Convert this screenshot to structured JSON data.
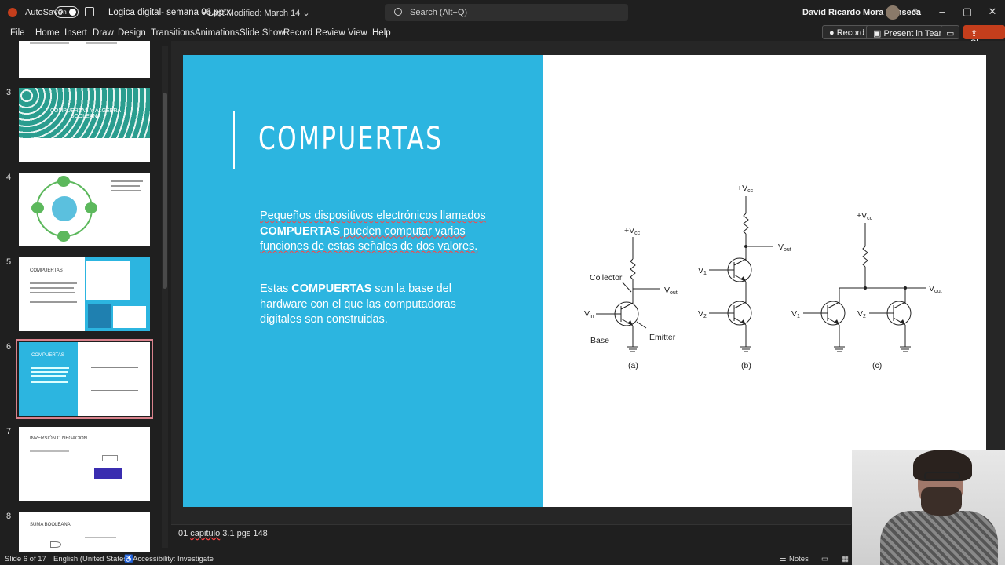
{
  "titlebar": {
    "autosave_label": "AutoSave",
    "autosave_state": "On",
    "document_title": "Logica digital- semana 06.pptx",
    "last_modified": "• Last Modified: March 14 ⌄",
    "search_placeholder": "Search (Alt+Q)",
    "user_name": "David Ricardo Mora Fonseca"
  },
  "ribbon": {
    "tabs": [
      "File",
      "Home",
      "Insert",
      "Draw",
      "Design",
      "Transitions",
      "Animations",
      "Slide Show",
      "Record",
      "Review",
      "View",
      "Help"
    ],
    "record_label": "Record",
    "present_label": "Present in Teams",
    "share_label": "Share"
  },
  "thumbnails": [
    {
      "num": "3",
      "title": "COMPUERTAS Y ÁLGEBRA BOOLEANA"
    },
    {
      "num": "4",
      "title": ""
    },
    {
      "num": "5",
      "title": "COMPUERTAS"
    },
    {
      "num": "6",
      "title": "COMPUERTAS"
    },
    {
      "num": "7",
      "title": "INVERSIÓN O NEGACIÓN"
    },
    {
      "num": "8",
      "title": "SUMA BOOLEANA"
    }
  ],
  "slide": {
    "title": "COMPUERTAS",
    "p1_a": "Pequeños dispositivos electrónicos llamados ",
    "p1_b": "COMPUERTAS",
    "p1_c": " pueden computar varias funciones de estas señales de dos valores.",
    "p2_a": "Estas ",
    "p2_b": "COMPUERTAS",
    "p2_c": " son la base del hardware con el que las computadoras digitales son construidas."
  },
  "diagram": {
    "labels": {
      "vcc": "+V",
      "vcc_sub": "cc",
      "vout": "V",
      "vout_sub": "out",
      "vin": "V",
      "vin_sub": "in",
      "v1": "V",
      "v1_sub": "1",
      "v2": "V",
      "v2_sub": "2",
      "collector": "Collector",
      "base": "Base",
      "emitter": "Emitter",
      "a": "(a)",
      "b": "(b)",
      "c": "(c)"
    }
  },
  "notes": {
    "text_pre": "01 ",
    "text_u": "capitulo",
    "text_post": " 3.1 pgs 148"
  },
  "status": {
    "slide_count": "Slide 6 of 17",
    "language": "English (United States)",
    "accessibility": "Accessibility: Investigate",
    "notes_label": "Notes"
  }
}
